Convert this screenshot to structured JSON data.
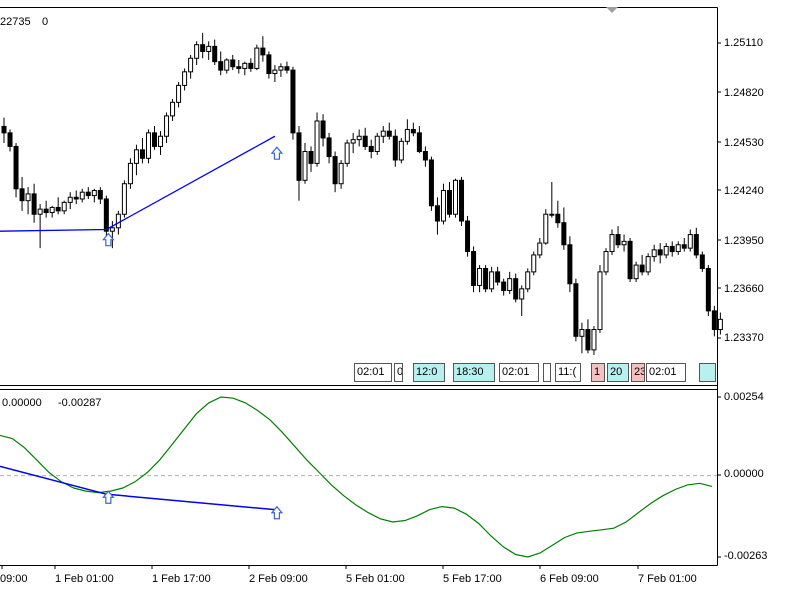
{
  "main_panel": {
    "header": {
      "text_a": "22735",
      "text_b": "0"
    },
    "price_labels": [
      "1.25110",
      "1.24820",
      "1.24530",
      "1.24240",
      "1.23950",
      "1.23660",
      "1.23370"
    ],
    "candles": [
      [
        1.24618,
        1.2467,
        1.2452,
        1.2458
      ],
      [
        1.2458,
        1.246,
        1.2447,
        1.245
      ],
      [
        1.245,
        1.2452,
        1.242,
        1.2425
      ],
      [
        1.2425,
        1.2432,
        1.2412,
        1.2418
      ],
      [
        1.2418,
        1.2426,
        1.241,
        1.2422
      ],
      [
        1.2422,
        1.2428,
        1.2405,
        1.241
      ],
      [
        1.241,
        1.2416,
        1.239,
        1.2413
      ],
      [
        1.2413,
        1.2418,
        1.2408,
        1.2411
      ],
      [
        1.2411,
        1.2415,
        1.2408,
        1.2414
      ],
      [
        1.2414,
        1.242,
        1.241,
        1.2412
      ],
      [
        1.2412,
        1.2418,
        1.241,
        1.2417
      ],
      [
        1.2417,
        1.2423,
        1.2413,
        1.242
      ],
      [
        1.242,
        1.2424,
        1.2416,
        1.2419
      ],
      [
        1.2419,
        1.2425,
        1.2417,
        1.2423
      ],
      [
        1.2423,
        1.2426,
        1.2419,
        1.2421
      ],
      [
        1.2421,
        1.2425,
        1.2417,
        1.2424
      ],
      [
        1.2424,
        1.2426,
        1.2416,
        1.2419
      ],
      [
        1.2419,
        1.2421,
        1.2396,
        1.24
      ],
      [
        1.24,
        1.2406,
        1.239,
        1.2402
      ],
      [
        1.2402,
        1.2412,
        1.2398,
        1.241
      ],
      [
        1.241,
        1.243,
        1.2408,
        1.2428
      ],
      [
        1.2428,
        1.2443,
        1.2425,
        1.244
      ],
      [
        1.244,
        1.2451,
        1.2433,
        1.2448
      ],
      [
        1.2448,
        1.2455,
        1.244,
        1.2443
      ],
      [
        1.2443,
        1.246,
        1.244,
        1.2458
      ],
      [
        1.2458,
        1.2462,
        1.2448,
        1.245
      ],
      [
        1.245,
        1.2459,
        1.2445,
        1.2456
      ],
      [
        1.2456,
        1.247,
        1.2452,
        1.2468
      ],
      [
        1.2468,
        1.2478,
        1.2465,
        1.2476
      ],
      [
        1.2476,
        1.2488,
        1.2473,
        1.2486
      ],
      [
        1.2486,
        1.2496,
        1.2483,
        1.2494
      ],
      [
        1.2494,
        1.2504,
        1.249,
        1.2502
      ],
      [
        1.2502,
        1.2512,
        1.2498,
        1.251
      ],
      [
        1.251,
        1.2517,
        1.2502,
        1.2506
      ],
      [
        1.2506,
        1.2512,
        1.2501,
        1.2509
      ],
      [
        1.2509,
        1.2513,
        1.2498,
        1.25
      ],
      [
        1.25,
        1.2506,
        1.2492,
        1.2495
      ],
      [
        1.2495,
        1.2502,
        1.2493,
        1.2501
      ],
      [
        1.2501,
        1.2504,
        1.2495,
        1.2497
      ],
      [
        1.2497,
        1.2501,
        1.2493,
        1.2496
      ],
      [
        1.2496,
        1.25,
        1.2492,
        1.2499
      ],
      [
        1.2499,
        1.2502,
        1.2494,
        1.2496
      ],
      [
        1.2496,
        1.251,
        1.2495,
        1.2508
      ],
      [
        1.2508,
        1.2515,
        1.25,
        1.2504
      ],
      [
        1.2504,
        1.2506,
        1.249,
        1.2493
      ],
      [
        1.2493,
        1.2498,
        1.2488,
        1.2495
      ],
      [
        1.2495,
        1.2499,
        1.2491,
        1.2497
      ],
      [
        1.2497,
        1.25,
        1.2493,
        1.2495
      ],
      [
        1.2495,
        1.2497,
        1.2454,
        1.2458
      ],
      [
        1.2458,
        1.2462,
        1.2418,
        1.243
      ],
      [
        1.243,
        1.2452,
        1.2428,
        1.2447
      ],
      [
        1.2447,
        1.245,
        1.2435,
        1.244
      ],
      [
        1.244,
        1.247,
        1.2438,
        1.2465
      ],
      [
        1.2465,
        1.2469,
        1.245,
        1.2455
      ],
      [
        1.2455,
        1.2458,
        1.244,
        1.2444
      ],
      [
        1.2444,
        1.2447,
        1.2423,
        1.2428
      ],
      [
        1.2428,
        1.2442,
        1.2425,
        1.244
      ],
      [
        1.244,
        1.2454,
        1.2438,
        1.2452
      ],
      [
        1.2452,
        1.2458,
        1.2446,
        1.2454
      ],
      [
        1.2454,
        1.246,
        1.245,
        1.2456
      ],
      [
        1.2456,
        1.2461,
        1.2448,
        1.245
      ],
      [
        1.245,
        1.2454,
        1.2443,
        1.2447
      ],
      [
        1.2447,
        1.2458,
        1.2445,
        1.2456
      ],
      [
        1.2456,
        1.2462,
        1.2452,
        1.2459
      ],
      [
        1.2459,
        1.2464,
        1.2454,
        1.2456
      ],
      [
        1.2456,
        1.246,
        1.2438,
        1.2442
      ],
      [
        1.2442,
        1.2455,
        1.244,
        1.2453
      ],
      [
        1.2453,
        1.2466,
        1.2451,
        1.246
      ],
      [
        1.246,
        1.2464,
        1.2456,
        1.2458
      ],
      [
        1.2458,
        1.2462,
        1.2446,
        1.2447
      ],
      [
        1.2447,
        1.245,
        1.2438,
        1.2442
      ],
      [
        1.2442,
        1.2444,
        1.2412,
        1.2415
      ],
      [
        1.2415,
        1.242,
        1.2398,
        1.2406
      ],
      [
        1.2406,
        1.2428,
        1.2404,
        1.2424
      ],
      [
        1.2424,
        1.2429,
        1.2408,
        1.241
      ],
      [
        1.241,
        1.2431,
        1.2408,
        1.243
      ],
      [
        1.243,
        1.2432,
        1.2403,
        1.2406
      ],
      [
        1.2406,
        1.2409,
        1.2385,
        1.2388
      ],
      [
        1.2388,
        1.2391,
        1.2364,
        1.2368
      ],
      [
        1.2368,
        1.238,
        1.2364,
        1.2378
      ],
      [
        1.2378,
        1.238,
        1.2364,
        1.2366
      ],
      [
        1.2366,
        1.2379,
        1.2364,
        1.2376
      ],
      [
        1.2376,
        1.2379,
        1.2368,
        1.237
      ],
      [
        1.237,
        1.2372,
        1.2362,
        1.2365
      ],
      [
        1.2365,
        1.2376,
        1.2363,
        1.2372
      ],
      [
        1.2372,
        1.2375,
        1.2358,
        1.236
      ],
      [
        1.236,
        1.2368,
        1.235,
        1.2366
      ],
      [
        1.2366,
        1.2378,
        1.2364,
        1.2376
      ],
      [
        1.2376,
        1.2388,
        1.2374,
        1.2386
      ],
      [
        1.2386,
        1.2396,
        1.2384,
        1.2393
      ],
      [
        1.2393,
        1.2413,
        1.2392,
        1.241
      ],
      [
        1.241,
        1.2429,
        1.2408,
        1.241
      ],
      [
        1.241,
        1.2418,
        1.2402,
        1.2405
      ],
      [
        1.2405,
        1.2414,
        1.2389,
        1.2392
      ],
      [
        1.2392,
        1.2397,
        1.2364,
        1.2369
      ],
      [
        1.2369,
        1.2372,
        1.2335,
        1.2338
      ],
      [
        1.2338,
        1.2346,
        1.2328,
        1.2342
      ],
      [
        1.2342,
        1.2348,
        1.2328,
        1.233
      ],
      [
        1.233,
        1.2344,
        1.2327,
        1.2342
      ],
      [
        1.2342,
        1.238,
        1.234,
        1.2376
      ],
      [
        1.2376,
        1.239,
        1.2374,
        1.2388
      ],
      [
        1.2388,
        1.2401,
        1.2386,
        1.2398
      ],
      [
        1.2398,
        1.2403,
        1.239,
        1.2392
      ],
      [
        1.2392,
        1.2398,
        1.2388,
        1.2394
      ],
      [
        1.2394,
        1.2396,
        1.237,
        1.2372
      ],
      [
        1.2372,
        1.2382,
        1.237,
        1.238
      ],
      [
        1.238,
        1.2386,
        1.2374,
        1.2376
      ],
      [
        1.2376,
        1.2387,
        1.2374,
        1.2385
      ],
      [
        1.2385,
        1.2392,
        1.2382,
        1.2389
      ],
      [
        1.2389,
        1.2393,
        1.2381,
        1.2386
      ],
      [
        1.2386,
        1.2393,
        1.2384,
        1.2391
      ],
      [
        1.2391,
        1.2394,
        1.2385,
        1.2388
      ],
      [
        1.2388,
        1.2394,
        1.2386,
        1.2392
      ],
      [
        1.2392,
        1.2396,
        1.2388,
        1.239
      ],
      [
        1.239,
        1.2401,
        1.2388,
        1.2398
      ],
      [
        1.2398,
        1.2402,
        1.2384,
        1.2386
      ],
      [
        1.2386,
        1.2388,
        1.2376,
        1.2378
      ],
      [
        1.2378,
        1.238,
        1.235,
        1.2353
      ],
      [
        1.2353,
        1.2356,
        1.2338,
        1.2342
      ],
      [
        1.2342,
        1.2352,
        1.2339,
        1.2348
      ]
    ],
    "trend_line": {
      "color": "#0000ff",
      "points": [
        [
          0,
          1.24
        ],
        [
          17,
          1.2401
        ],
        [
          45,
          1.2456
        ]
      ]
    },
    "arrows": [
      {
        "index": 17,
        "price": 1.2395
      },
      {
        "index": 45,
        "price": 1.2446
      }
    ],
    "arrow_color": "#3b63d6",
    "time_boxes": [
      {
        "text": "02:01",
        "bg": "#ffffff"
      },
      {
        "text": "0",
        "bg": "#ffffff"
      },
      {
        "text": "12:0",
        "bg": "#b8f0f0"
      },
      {
        "text": "18:30",
        "bg": "#b8f0f0"
      },
      {
        "text": "02:01",
        "bg": "#ffffff"
      },
      {
        "text": "",
        "bg": "#ffffff"
      },
      {
        "text": "11:(",
        "bg": "#ffffff"
      },
      {
        "text": "1",
        "bg": "#f4c0c0"
      },
      {
        "text": "20",
        "bg": "#b8f0f0"
      },
      {
        "text": "23",
        "bg": "#f4c0c0"
      },
      {
        "text": "02:01",
        "bg": "#ffffff"
      },
      {
        "text": "",
        "bg": "#b8f0f0"
      }
    ]
  },
  "indicator_panel": {
    "header": {
      "value_a": "0.00000",
      "value_b": "-0.00287"
    },
    "scale_labels": [
      "0.00254",
      "0.00000",
      "-0.00263"
    ],
    "zero_line_color": "#b0b0b0",
    "oscillator_color": "#008000",
    "oscillator": [
      0.0013,
      0.0012,
      0.0009,
      0.0005,
      0.0001,
      -0.0002,
      -0.0004,
      -0.0005,
      -0.00055,
      -0.0005,
      -0.0004,
      -0.0002,
      0.0001,
      0.0005,
      0.001,
      0.0015,
      0.002,
      0.00235,
      0.00254,
      0.0025,
      0.00235,
      0.0021,
      0.0018,
      0.0014,
      0.00095,
      0.0005,
      0.0001,
      -0.0003,
      -0.00065,
      -0.00095,
      -0.0012,
      -0.0014,
      -0.0015,
      -0.00145,
      -0.0013,
      -0.0011,
      -0.001,
      -0.00105,
      -0.00125,
      -0.00155,
      -0.00195,
      -0.0023,
      -0.00255,
      -0.00263,
      -0.0025,
      -0.00225,
      -0.002,
      -0.00185,
      -0.0018,
      -0.00175,
      -0.0017,
      -0.0015,
      -0.0012,
      -0.0009,
      -0.00065,
      -0.00045,
      -0.0003,
      -0.00025,
      -0.00035
    ],
    "trend_line": {
      "color": "#0000ff",
      "points": [
        [
          0,
          0.0003
        ],
        [
          17,
          -0.0006
        ],
        [
          45,
          -0.0011
        ]
      ]
    },
    "arrows": [
      {
        "index": 17,
        "value": -0.0007
      },
      {
        "index": 45,
        "value": -0.0012
      }
    ]
  },
  "time_labels": [
    "09:00",
    "1 Feb 01:00",
    "1 Feb 17:00",
    "2 Feb 09:00",
    "5 Feb 01:00",
    "5 Feb 17:00",
    "6 Feb 09:00",
    "7 Feb 01:00"
  ],
  "colors": {
    "background": "#ffffff",
    "border": "#000000",
    "candle": "#000000"
  }
}
